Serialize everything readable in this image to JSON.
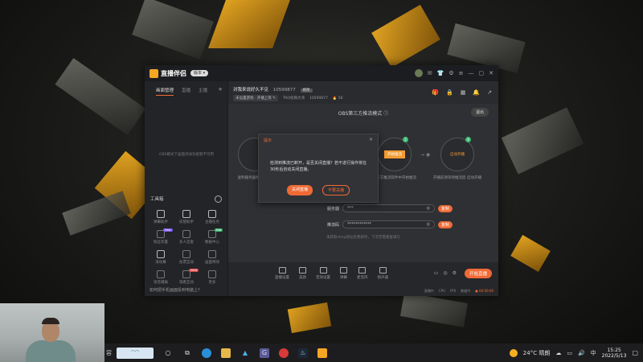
{
  "app": {
    "name": "直播伴侣",
    "version_pill": "版本 ▾",
    "room_title": "对我来说好久不见",
    "room_id": "10599877",
    "room_pill": "修改",
    "room_tag1": "未设置游戏 · 开播上等 ✎",
    "room_host": "TAO侦探大湾",
    "room_host_id": "10599877",
    "room_heat": "🔥 56"
  },
  "sidebar": {
    "tabs": [
      "画面管理",
      "直播",
      "主播"
    ],
    "empty_text": "OBS模式下画面添加功能暂不可用",
    "tools_title": "工具箱",
    "tools": [
      {
        "label": "弹幕助手",
        "badge": "",
        "dim": false
      },
      {
        "label": "房管助手",
        "badge": "",
        "dim": false
      },
      {
        "label": "主播任务",
        "badge": "",
        "dim": false
      },
      {
        "label": "粉丝装置",
        "badge": "New",
        "dim": true
      },
      {
        "label": "多人连麦",
        "badge": "",
        "dim": true
      },
      {
        "label": "数据中心",
        "badge": "Hot",
        "dim": true
      },
      {
        "label": "滚动幕",
        "badge": "",
        "dim": false
      },
      {
        "label": "投票互动",
        "badge": "",
        "dim": true
      },
      {
        "label": "画面特效",
        "badge": "",
        "dim": true
      },
      {
        "label": "语音播报",
        "badge": "",
        "dim": true
      },
      {
        "label": "观看互动",
        "badge": "NEW",
        "dim": true
      },
      {
        "label": "更多",
        "badge": "",
        "dim": true
      }
    ],
    "bottom_text": "如何把手机画面投到电脑上?"
  },
  "stage": {
    "mode_title": "OBS第三方推流模式 ⓘ",
    "exit_label": "退出",
    "step1_sub": "复制服务器和推流码",
    "step2_btn": "开始推流",
    "step2_num": "2",
    "step2_sub": "第三方推流软件中开始推流",
    "step3_text": "启动开播",
    "step3_num": "4",
    "step3_sub": "开播前请等待推流后 启动开播",
    "server_label": "服务器",
    "server_value": "***",
    "key_label": "推流码",
    "key_value": "************",
    "copy_label": "复制",
    "hint": "未获取rtmp地址有更新时，下次无需重复填写"
  },
  "modal": {
    "title": "提示",
    "close": "×",
    "message": "检测到推流已断开，是否关闭直播？若不进行操作将在30秒后自动关闭直播。",
    "primary": "关闭直播",
    "secondary": "不要关播"
  },
  "bottombar": {
    "tools": [
      "直播设置",
      "美颜",
      "音效设置",
      "弹幕",
      "麦克风",
      "扬声器"
    ],
    "start_label": "开始直播",
    "status": [
      "直播中",
      "CPU",
      "FPS",
      "数据中",
      "● 00:00:00"
    ]
  },
  "taskbar": {
    "left_text": "容",
    "clock_time": "15:25",
    "clock_date": "2022/5/13",
    "weather": "24°C 晴朗"
  }
}
